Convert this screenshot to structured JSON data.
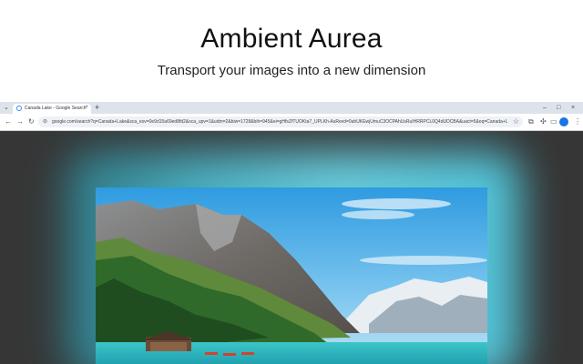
{
  "hero": {
    "title": "Ambient Aurea",
    "subtitle": "Transport your images into a new dimension"
  },
  "browser": {
    "tab": {
      "title": "Canada Lake - Google Search",
      "close_icon": "×",
      "new_tab_icon": "+"
    },
    "window_controls": {
      "minimize": "–",
      "maximize": "□",
      "close": "×"
    },
    "tab_list_icon": "⌄",
    "nav": {
      "back": "←",
      "forward": "→",
      "reload": "↻"
    },
    "address": {
      "icon": "⊜",
      "url": "google.com/search?q=Canada+Lake&sca_esv=0e9d15a69ed8fd2&sca_upv=1&udm=2&biw=1728&bih=945&ei=gHfsZfTUOKta7_UPLKh-AsRved=0ahUKEwjUmuC3OCPAhUsRuIHRRPCL0Q4dUDCBA&uact=5&oq=Canada+Lake",
      "star": "☆"
    },
    "toolbar_icons": {
      "extensions": "⧉",
      "puzzle": "✣",
      "split": "▭",
      "menu": "⋮"
    }
  },
  "photo": {
    "subject": "mountain-lake-scene"
  },
  "colors": {
    "glow": "#4fc9de",
    "viewport_bg": "#363636",
    "tabbar_bg": "#dde3ea"
  }
}
